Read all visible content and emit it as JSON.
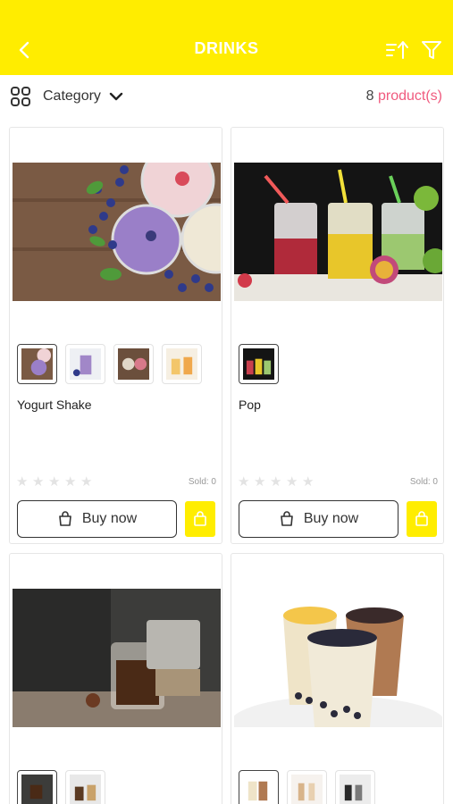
{
  "header": {
    "title": "DRINKS",
    "back_icon": "chevron-left-icon",
    "sort_icon": "sort-icon",
    "filter_icon": "filter-icon",
    "background": "#FFED00"
  },
  "category_bar": {
    "label": "Category",
    "count": "8",
    "count_unit": "product(s)"
  },
  "products": [
    {
      "name": "Yogurt Shake",
      "sold": "Sold: 0",
      "buy_label": "Buy now",
      "rating": 0,
      "thumbnail_count": 4
    },
    {
      "name": "Pop",
      "sold": "Sold: 0",
      "buy_label": "Buy now",
      "rating": 0,
      "thumbnail_count": 1
    },
    {
      "name": "",
      "thumbnail_count": 2
    },
    {
      "name": "",
      "thumbnail_count": 3
    }
  ],
  "colors": {
    "accent": "#FFED00",
    "count_highlight": "#F05A7E"
  }
}
